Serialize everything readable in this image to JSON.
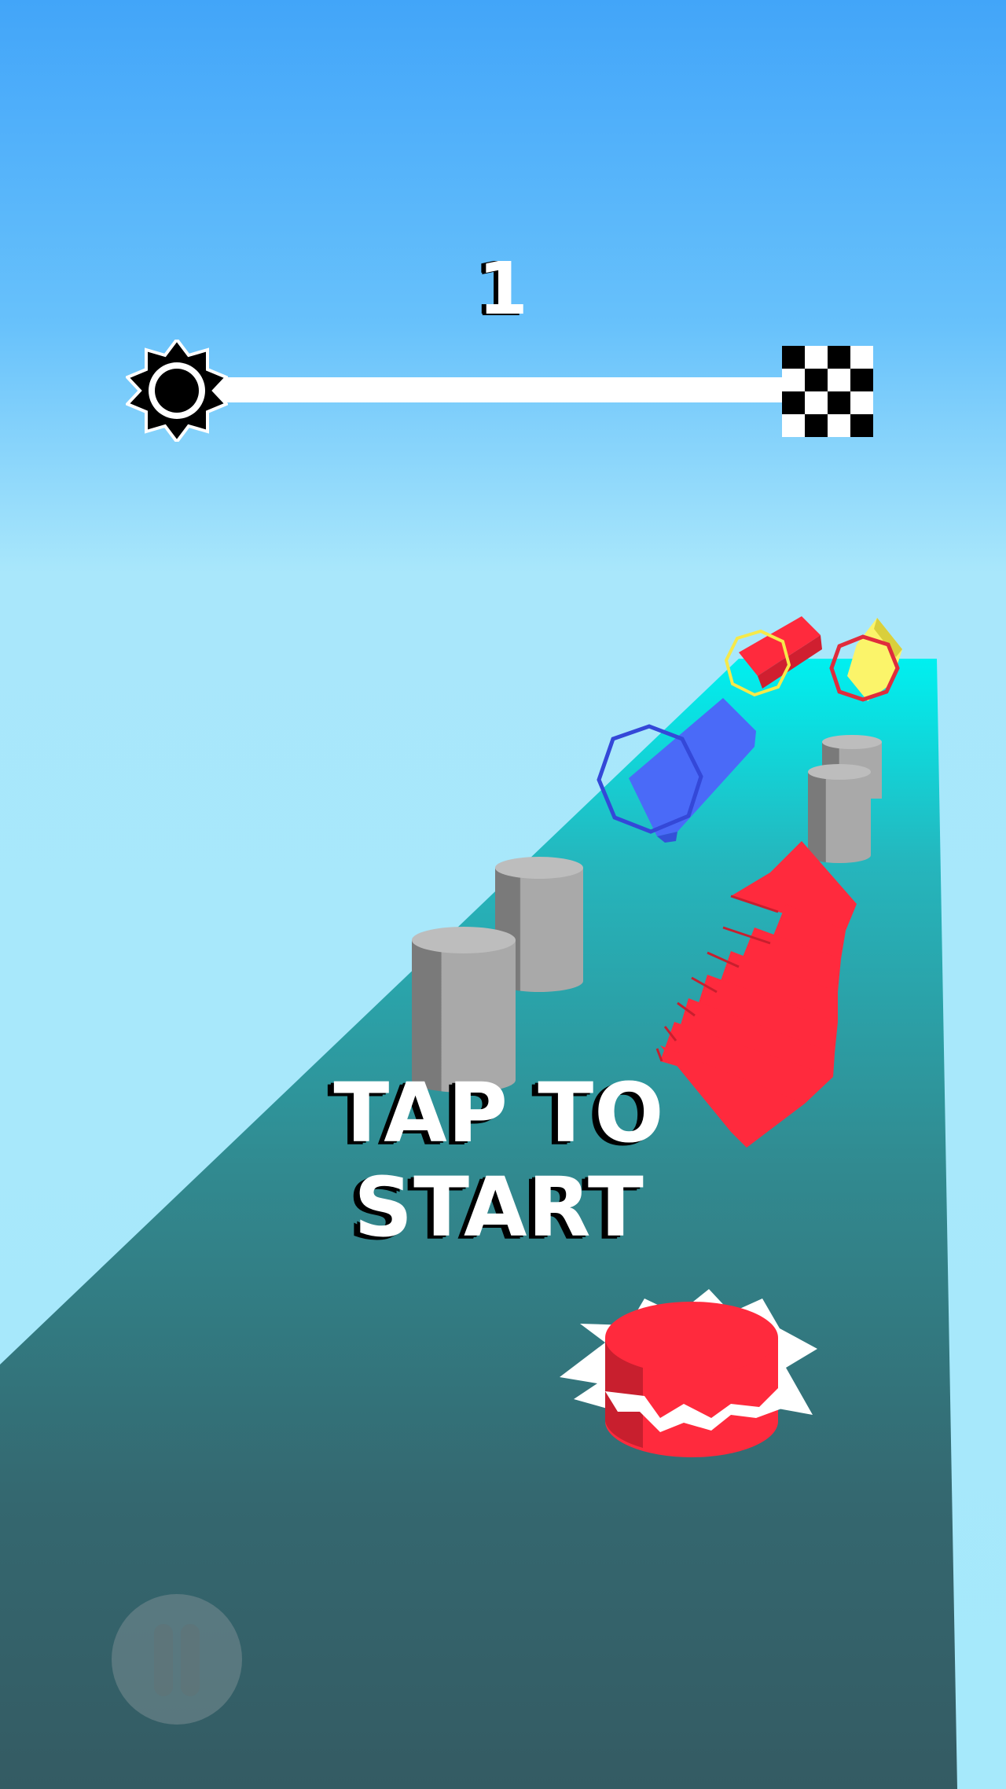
{
  "hud": {
    "level": "1",
    "progress": 0,
    "start_icon": "spiky-ball-icon",
    "finish_icon": "checkered-flag-icon"
  },
  "prompt": {
    "text": "TAP TO START"
  },
  "controls": {
    "pause_icon": "pause-icon"
  },
  "colors": {
    "sky_top": "#42a5f9",
    "sky_bottom": "#a6e9fb",
    "track_far": "#00f0f0",
    "track_near": "#345b63",
    "obstacle_gray": "#a8a8a8",
    "player_red": "#ff2a3d",
    "block_blue": "#4a6af8",
    "block_yellow": "#fbf46a"
  }
}
